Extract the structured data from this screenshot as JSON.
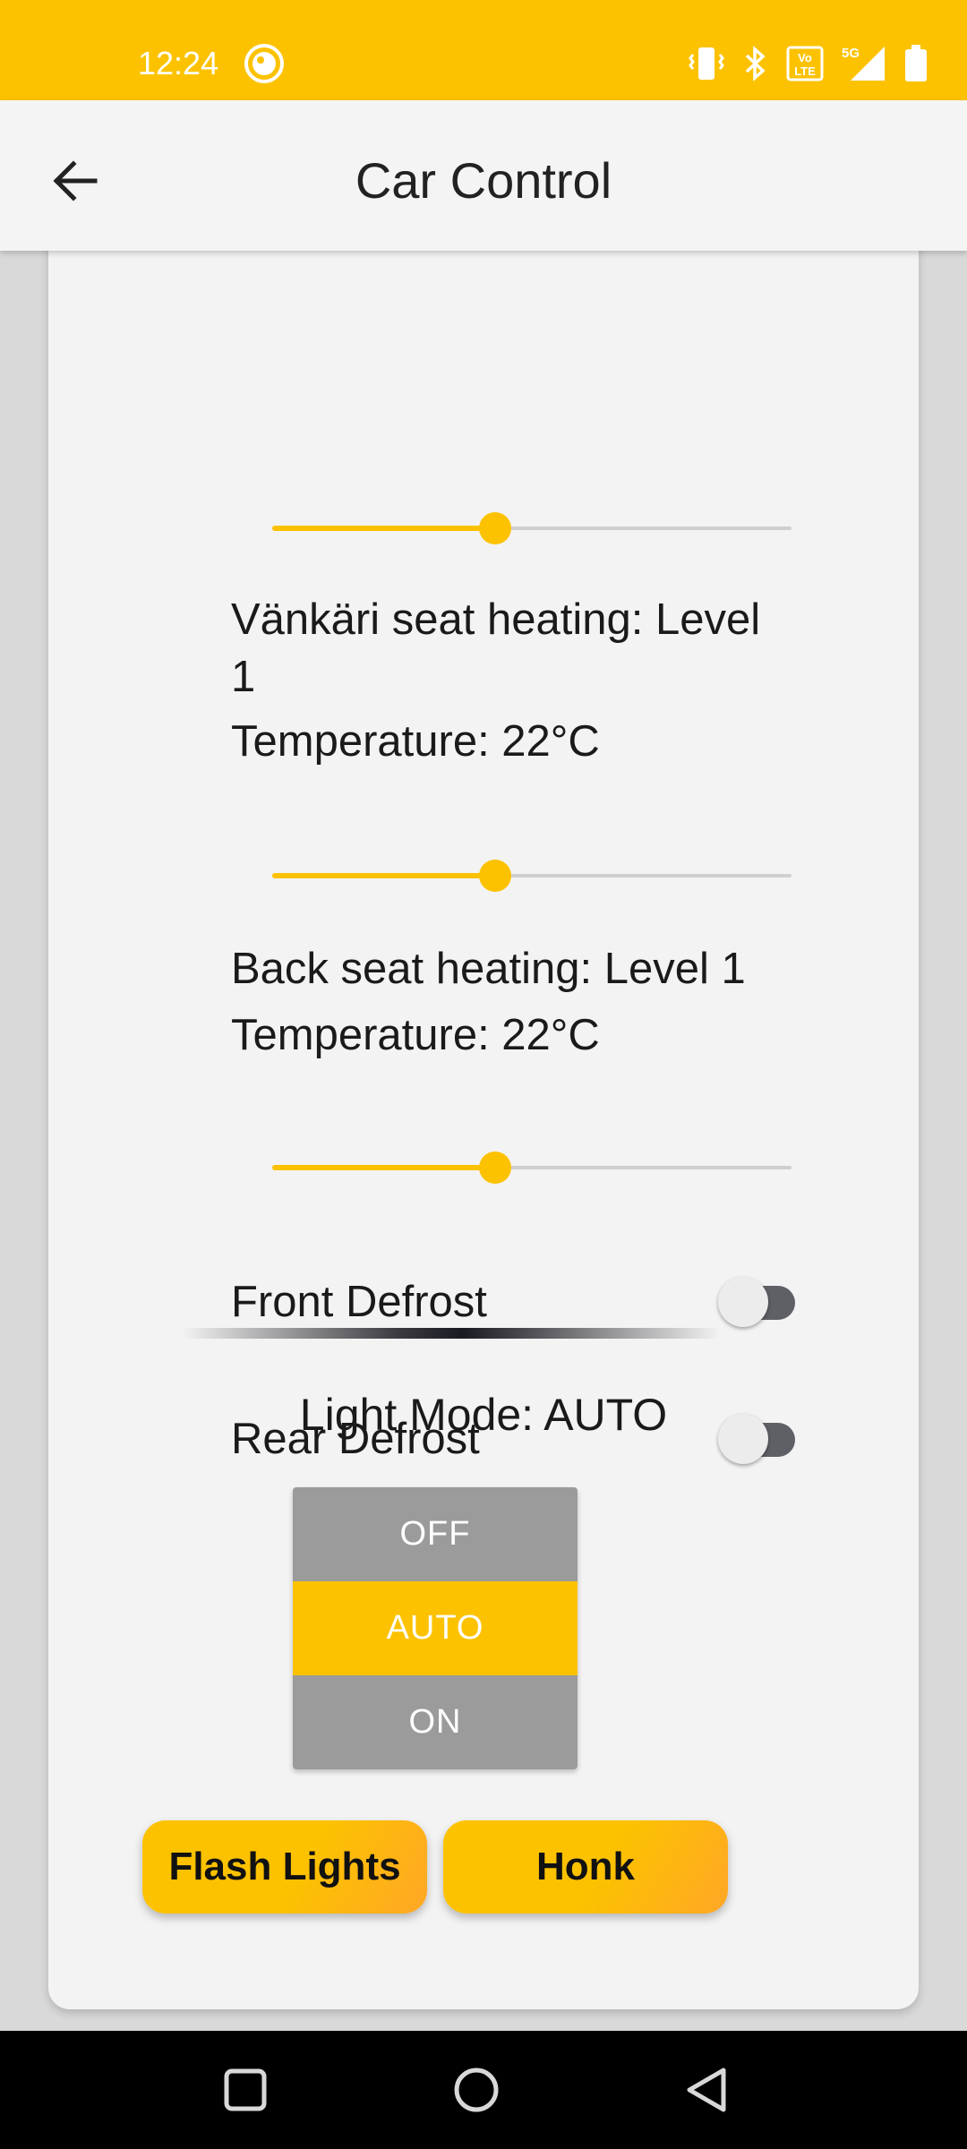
{
  "status_bar": {
    "time": "12:24",
    "network": "5G",
    "volte": "Vo LTE",
    "icons": [
      "face-icon",
      "vibrate-icon",
      "bluetooth-icon",
      "volte-icon",
      "signal-icon",
      "battery-icon"
    ]
  },
  "app_bar": {
    "title": "Car Control",
    "back_icon": "arrow-back-icon"
  },
  "sliders": {
    "top": {
      "value": 0.43
    },
    "front_passenger": {
      "value": 0.43
    },
    "back": {
      "value": 0.43
    }
  },
  "front_passenger_seat": {
    "heating_line1": "Vänkäri seat heating: Level",
    "heating_line2": "1",
    "temperature": "Temperature: 22°C"
  },
  "back_seat": {
    "heating": "Back seat heating: Level 1",
    "temperature": "Temperature: 22°C"
  },
  "defrost": {
    "front_label": "Front Defrost",
    "front_on": false,
    "rear_label": "Rear Defrost",
    "rear_on": false
  },
  "light_mode": {
    "label": "Light Mode: AUTO",
    "options": [
      "OFF",
      "AUTO",
      "ON"
    ],
    "selected": "AUTO"
  },
  "actions": {
    "flash_label": "Flash Lights",
    "honk_label": "Honk"
  },
  "nav_bar": {
    "icons": [
      "recents-square-icon",
      "home-circle-icon",
      "back-triangle-icon"
    ]
  },
  "colors": {
    "accent": "#fcc200",
    "accent_orange": "#ffa726",
    "inactive_button": "#9b9b9b",
    "toggle_track": "#5f6066",
    "card_background": "#f3f3f3"
  }
}
